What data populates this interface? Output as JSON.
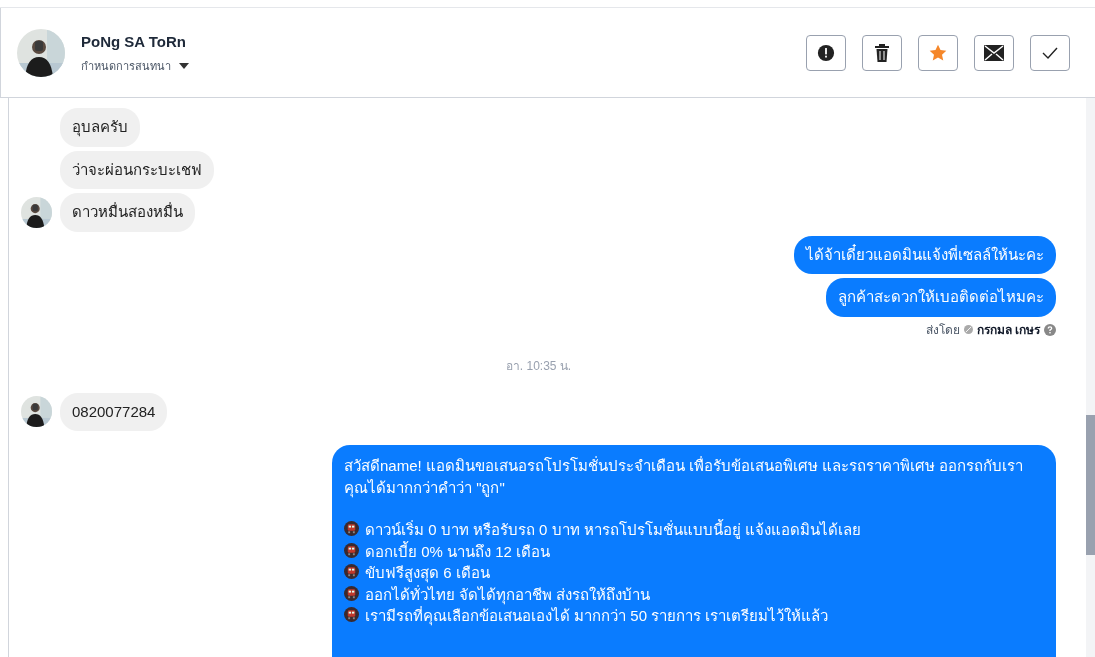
{
  "header": {
    "name": "PoNg SA ToRn",
    "subtitle": "กำหนดการสนทนา",
    "actions": [
      {
        "kind": "alert"
      },
      {
        "kind": "trash"
      },
      {
        "kind": "star",
        "on": true
      },
      {
        "kind": "mail"
      },
      {
        "kind": "check"
      }
    ]
  },
  "messages": [
    {
      "kind": "incoming",
      "text": "อุบลครับ",
      "avatar": false
    },
    {
      "kind": "incoming",
      "text": "ว่าจะผ่อนกระบะเชฟ",
      "avatar": false
    },
    {
      "kind": "incoming",
      "text": "ดาวหมื่นสองหมื่น",
      "avatar": true
    },
    {
      "kind": "outgoing",
      "text": "ได้จ้าเดี๋ยวแอดมินแจ้งพี่เซลล์ให้นะคะ"
    },
    {
      "kind": "outgoing",
      "text": "ลูกค้าสะดวกให้เบอติดต่อไหมคะ"
    },
    {
      "kind": "sent_by",
      "label": "ส่งโดย",
      "sender": "กรกมล เกษร"
    },
    {
      "kind": "time",
      "text": "อา. 10:35 น."
    },
    {
      "kind": "incoming",
      "text": "0820077284",
      "avatar": true
    },
    {
      "kind": "promo",
      "intro": "สวัสดีname! แอดมินขอเสนอรถโปรโมชั่นประจำเดือน เพื่อรับข้อเสนอพิเศษ และรถราคาพิเศษ ออกรถกับเรา คุณได้มากกว่าคำว่า \"ถูก\"",
      "bullets": [
        "ดาวน์เริ่ม 0 บาท หรือรับรถ 0 บาท หารถโปรโมชั่นแบบนี้อยู่ แจ้งแอดมินได้เลย",
        "ดอกเบี้ย 0% นานถึง 12 เดือน",
        "ขับฟรีสูงสุด 6 เดือน",
        "ออกได้ทั่วไทย จัดได้ทุกอาชีพ ส่งรถให้ถึงบ้าน",
        "เรามีรถที่คุณเลือกข้อเสนอเองได้ มากกว่า 50 รายการ เราเตรียมไว้ให้แล้ว"
      ]
    }
  ]
}
